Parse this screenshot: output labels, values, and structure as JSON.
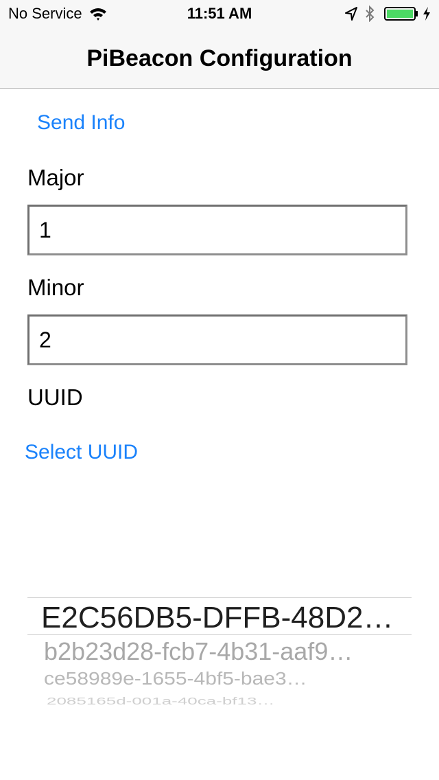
{
  "status_bar": {
    "carrier": "No Service",
    "time": "11:51 AM"
  },
  "nav": {
    "title": "PiBeacon Configuration"
  },
  "form": {
    "send_info_label": "Send Info",
    "major_label": "Major",
    "major_value": "1",
    "minor_label": "Minor",
    "minor_value": "2",
    "uuid_label": "UUID",
    "select_uuid_label": "Select UUID"
  },
  "uuid_picker": {
    "options": [
      "E2C56DB5-DFFB-48D2…",
      "b2b23d28-fcb7-4b31-aaf9…",
      "ce58989e-1655-4bf5-bae3…",
      "2085165d-001a-40ca-bf13…"
    ],
    "selected_index": 0
  },
  "colors": {
    "link": "#1a82fb",
    "bar_background": "#f7f7f7",
    "battery": "#4cd964"
  },
  "icons": {
    "wifi": "wifi-icon",
    "location": "location-arrow-icon",
    "bluetooth": "bluetooth-icon",
    "battery": "battery-icon",
    "charging": "charging-bolt-icon"
  }
}
